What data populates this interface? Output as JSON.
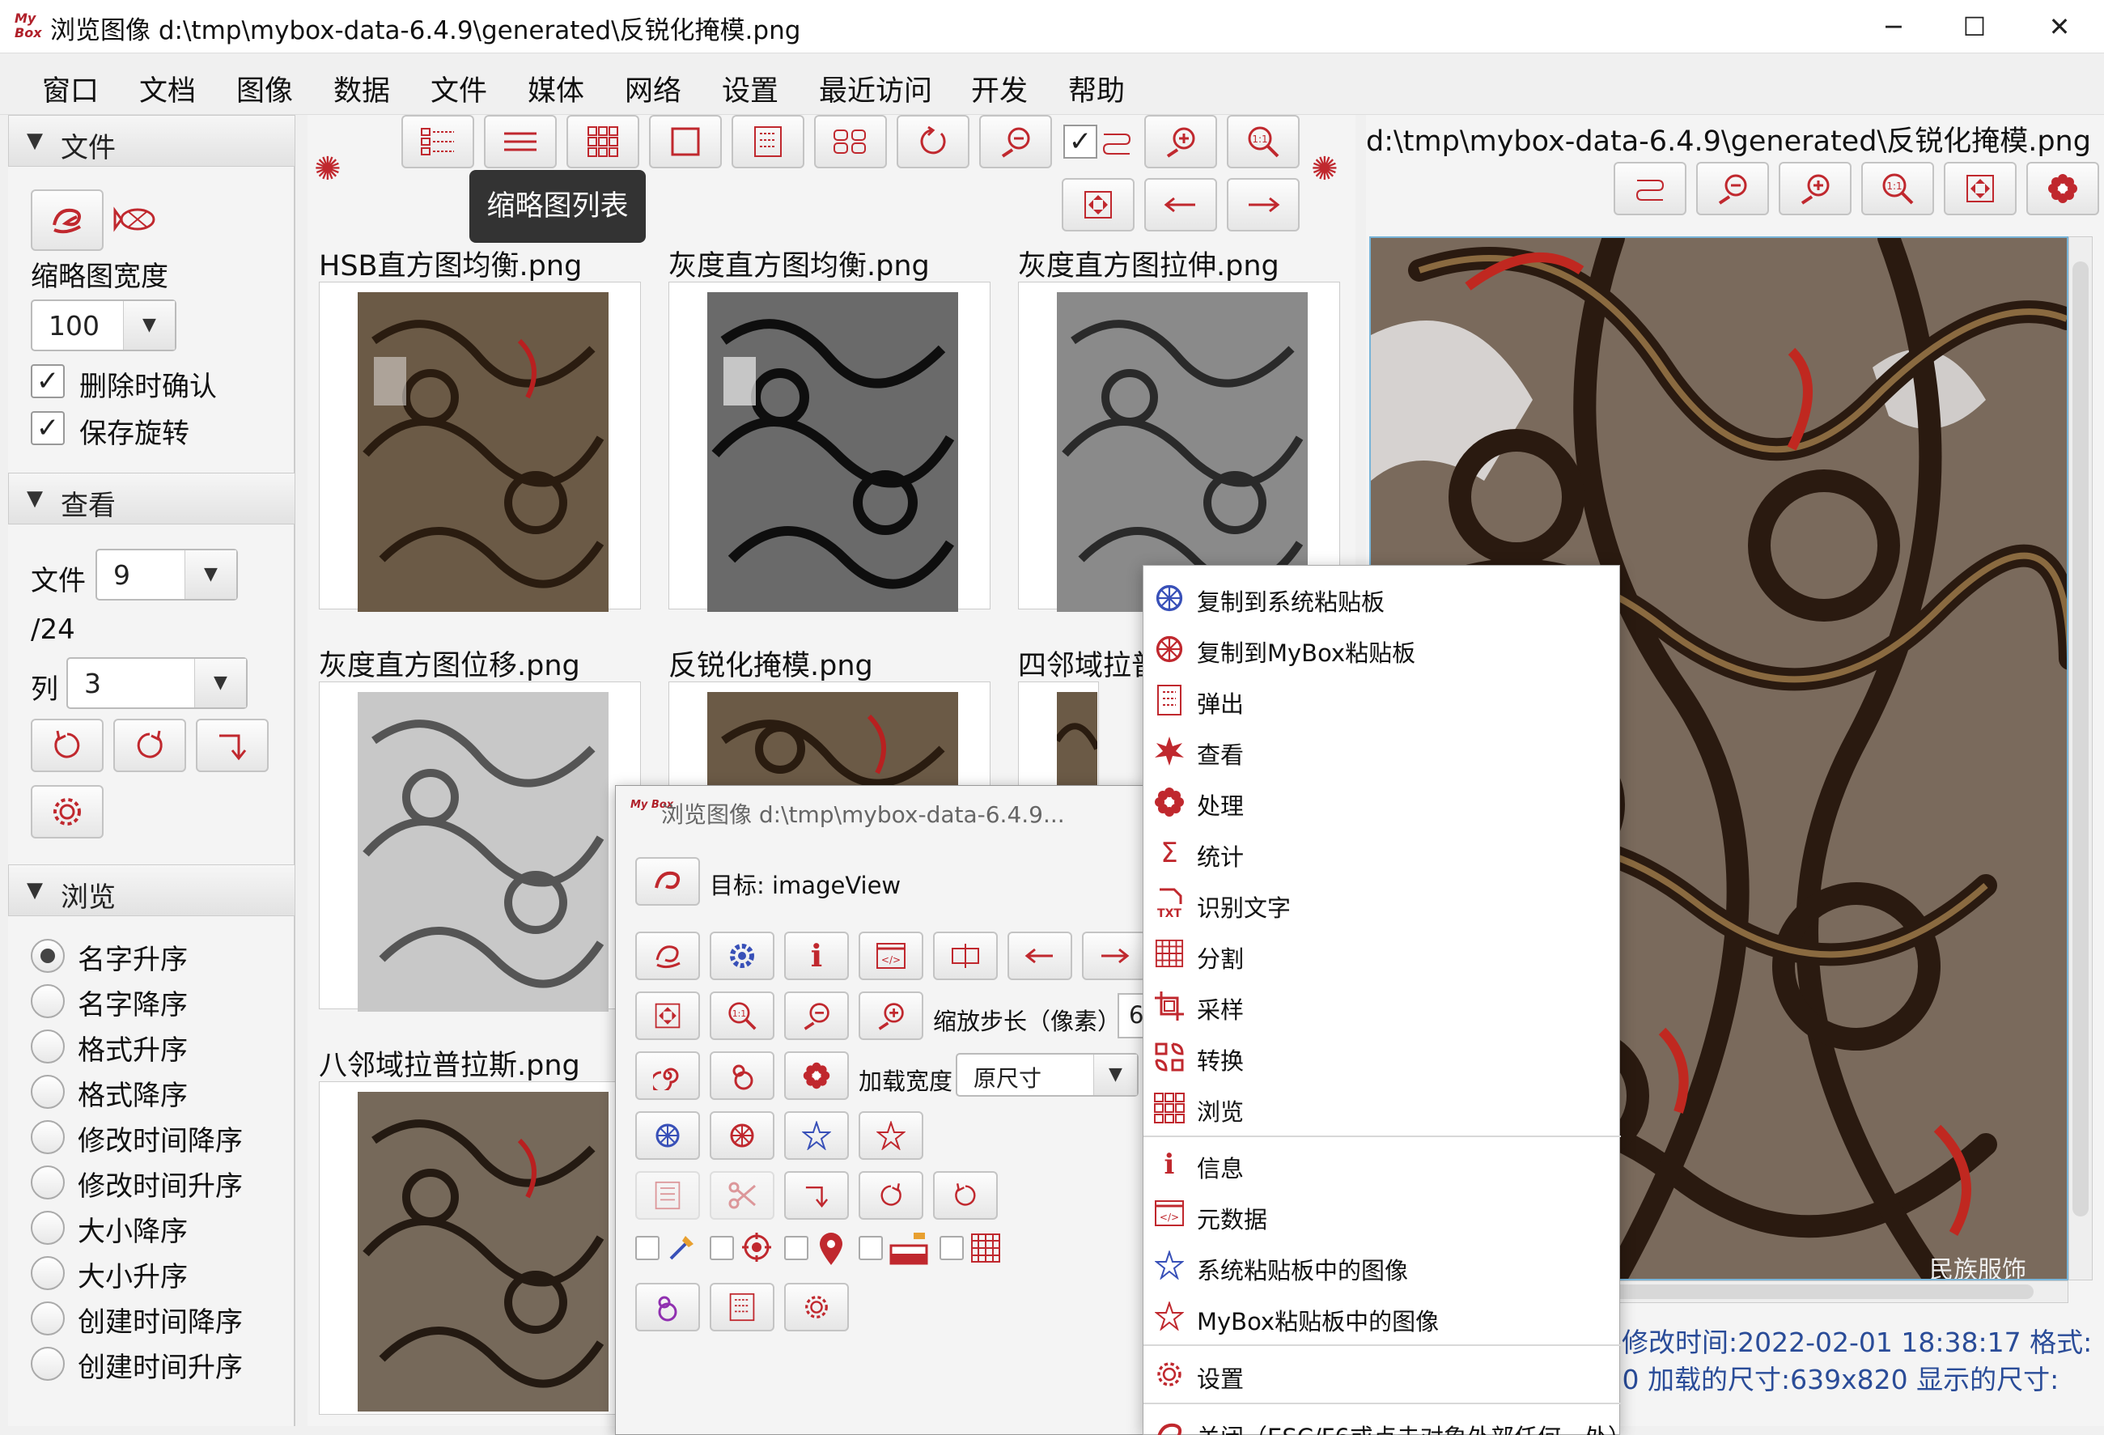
{
  "window": {
    "logo_text": "My Box",
    "title": "浏览图像 d:\\tmp\\mybox-data-6.4.9\\generated\\反锐化掩模.png",
    "minimize": "─",
    "maximize": "☐",
    "close": "✕"
  },
  "menu": [
    "窗口",
    "文档",
    "图像",
    "数据",
    "文件",
    "媒体",
    "网络",
    "设置",
    "最近访问",
    "开发",
    "帮助"
  ],
  "left": {
    "file_section": "文件",
    "thumb_width_label": "缩略图宽度",
    "thumb_width_value": "100",
    "confirm_delete": "删除时确认",
    "save_rotation": "保存旋转",
    "view_section": "查看",
    "file_label": "文件",
    "file_value": "9",
    "total": "/24",
    "col_label": "列",
    "col_value": "3",
    "browse_section": "浏览",
    "sort_options": [
      "名字升序",
      "名字降序",
      "格式升序",
      "格式降序",
      "修改时间降序",
      "修改时间升序",
      "大小降序",
      "大小升序",
      "创建时间降序",
      "创建时间升序"
    ],
    "sort_selected": 0
  },
  "tooltip": "缩略图列表",
  "thumbs": [
    {
      "name": "HSB直方图均衡.png"
    },
    {
      "name": "灰度直方图均衡.png"
    },
    {
      "name": "灰度直方图拉伸.png"
    },
    {
      "name": "灰度直方图位移.png"
    },
    {
      "name": "反锐化掩模.png"
    },
    {
      "name": "四邻域拉普"
    },
    {
      "name": "八邻域拉普拉斯.png"
    }
  ],
  "right": {
    "path": "d:\\tmp\\mybox-data-6.4.9\\generated\\反锐化掩模.png",
    "watermark": "民族服饰",
    "status1": "修改时间:2022-02-01 18:38:17  格式:",
    "status2": ".0  加载的尺寸:639x820  显示的尺寸:"
  },
  "popup": {
    "logo_text": "My Box",
    "title": "浏览图像 d:\\tmp\\mybox-data-6.4.9...",
    "target": "目标: imageView",
    "zoom_step_label": "缩放步长（像素）",
    "zoom_step_value": "6",
    "load_width_label": "加载宽度",
    "load_width_value": "原尺寸"
  },
  "context_menu": {
    "items": [
      {
        "label": "复制到系统粘贴板",
        "icon": "copy-system-icon"
      },
      {
        "label": "复制到MyBox粘贴板",
        "icon": "copy-mybox-icon"
      },
      {
        "label": "弹出",
        "icon": "popup-icon"
      },
      {
        "label": "查看",
        "icon": "view-icon"
      },
      {
        "label": "处理",
        "icon": "process-icon"
      },
      {
        "label": "统计",
        "icon": "sigma-icon"
      },
      {
        "label": "识别文字",
        "icon": "ocr-icon"
      },
      {
        "label": "分割",
        "icon": "grid-icon"
      },
      {
        "label": "采样",
        "icon": "crop-icon"
      },
      {
        "label": "转换",
        "icon": "convert-icon"
      },
      {
        "label": "浏览",
        "icon": "browse-icon"
      },
      {
        "label": "信息",
        "icon": "info-icon"
      },
      {
        "label": "元数据",
        "icon": "metadata-icon"
      },
      {
        "label": "系统粘贴板中的图像",
        "icon": "system-clipboard-icon"
      },
      {
        "label": "MyBox粘贴板中的图像",
        "icon": "mybox-clipboard-icon"
      },
      {
        "label": "设置",
        "icon": "gear-icon"
      },
      {
        "label": "关闭（ESC/F6或点击对象外部任何一处）",
        "icon": "close-icon"
      }
    ]
  },
  "colors": {
    "accent": "#c0282e",
    "status_text": "#2a4c98",
    "selection": "#78b4d8"
  }
}
